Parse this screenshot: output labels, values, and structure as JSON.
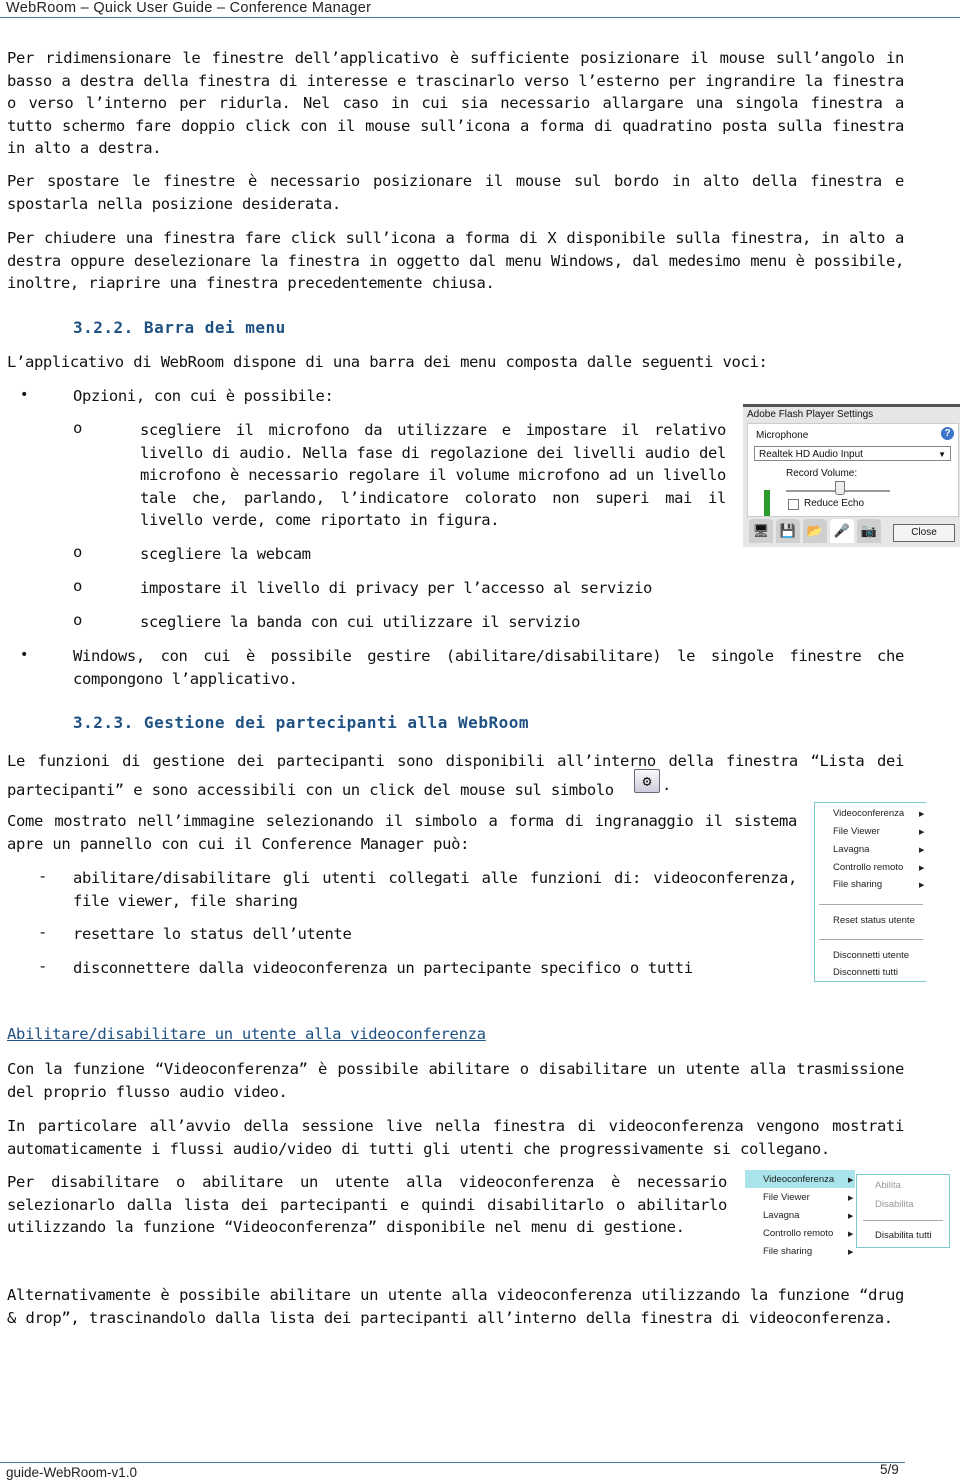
{
  "header": {
    "title": "WebRoom – Quick User Guide – Conference Manager"
  },
  "paragraphs": {
    "resize": "Per ridimensionare le finestre dell’applicativo è sufficiente posizionare il mouse sull’angolo in basso a destra della finestra di interesse e trascinarlo verso l’esterno per ingrandire la finestra o verso l’interno per ridurla. Nel caso in cui sia necessario allargare una singola finestra a tutto schermo fare doppio click con il mouse sull’icona a forma di quadratino posta sulla finestra in alto a destra.",
    "move": "Per spostare le finestre è necessario posizionare il mouse sul bordo in alto della finestra e spostarla nella posizione desiderata.",
    "close": "Per chiudere una finestra fare click sull’icona a forma di X disponibile sulla finestra, in alto a destra oppure deselezionare la finestra in oggetto dal menu Windows, dal medesimo menu è possibile, inoltre, riaprire una finestra precedentemente chiusa.",
    "menu_intro": "L’applicativo di WebRoom dispone di una barra dei menu composta dalle seguenti voci:",
    "participants_1": "Le funzioni di gestione dei partecipanti sono disponibili all’interno della finestra “Lista dei partecipanti” e sono accessibili con un click del mouse sul simbolo",
    "participants_1_end": ".",
    "participants_2": "Come mostrato nell’immagine selezionando il simbolo a forma di ingranaggio il sistema apre un pannello con cui il Conference Manager può:",
    "video_1": "Con la funzione “Videoconferenza” è possibile abilitare o disabilitare un utente alla trasmissione del proprio flusso audio video.",
    "video_2": "In particolare all’avvio della sessione live nella finestra di videoconferenza vengono mostrati automaticamente i flussi audio/video di tutti gli utenti che progressivamente si collegano.",
    "video_3": "Per disabilitare o abilitare un utente alla videoconferenza è necessario selezionarlo dalla lista dei partecipanti e quindi disabilitarlo o abilitarlo utilizzando la funzione “Videoconferenza” disponibile nel menu di gestione.",
    "video_4": "Alternativamente è possibile abilitare un utente alla videoconferenza utilizzando la funzione “drug & drop”, trascinandolo dalla lista dei partecipanti all’interno della finestra di videoconferenza."
  },
  "headings": {
    "menu_bar": "3.2.2. Barra dei menu",
    "participants": "3.2.3. Gestione dei partecipanti alla WebRoom",
    "enable_user": "Abilitare/disabilitare un utente alla videoconferenza"
  },
  "bullets": {
    "symbol": "•",
    "sub_symbol": "o",
    "dash_symbol": "-",
    "options": "Opzioni, con cui è possibile:",
    "options_sub": [
      "scegliere il microfono da utilizzare e impostare il relativo livello di audio. Nella fase di regolazione dei livelli audio del microfono è necessario regolare il volume microfono ad un livello tale che, parlando, l’indicatore colorato non superi mai il livello verde, come riportato in figura.",
      "scegliere la webcam",
      "impostare il livello di privacy per l’accesso al servizio",
      "scegliere la banda con cui utilizzare il servizio"
    ],
    "windows": "Windows, con cui è possibile gestire (abilitare/disabilitare) le singole finestre che compongono l’applicativo.",
    "manager_actions": [
      "abilitare/disabilitare gli utenti collegati alle funzioni di: videoconferenza, file viewer, file sharing",
      "resettare lo status dell’utente",
      "disconnettere dalla videoconferenza un partecipante specifico o tutti"
    ]
  },
  "flash_panel": {
    "title": "Adobe Flash Player Settings",
    "section": "Microphone",
    "help": "?",
    "device": "Realtek HD Audio Input",
    "record_volume_label": "Record Volume:",
    "record_volume_level": 0.5,
    "reduce_echo_label": "Reduce Echo",
    "reduce_echo_checked": false,
    "close_label": "Close"
  },
  "manager_menu": {
    "items": [
      "Videoconferenza",
      "File Viewer",
      "Lavagna",
      "Controllo remoto",
      "File sharing"
    ],
    "reset": "Reset status utente",
    "disconnect": [
      "Disconnetti utente",
      "Disconnetti tutti"
    ]
  },
  "video_menu": {
    "items": [
      "Videoconferenza",
      "File Viewer",
      "Lavagna",
      "Controllo remoto",
      "File sharing"
    ],
    "submenu": [
      "Abilita",
      "Disabilita"
    ],
    "submenu_all": "Disabilita tutti",
    "highlight_color": "#a8e4ea"
  },
  "footer": {
    "left": "guide-WebRoom-v1.0",
    "page": "5/9"
  }
}
